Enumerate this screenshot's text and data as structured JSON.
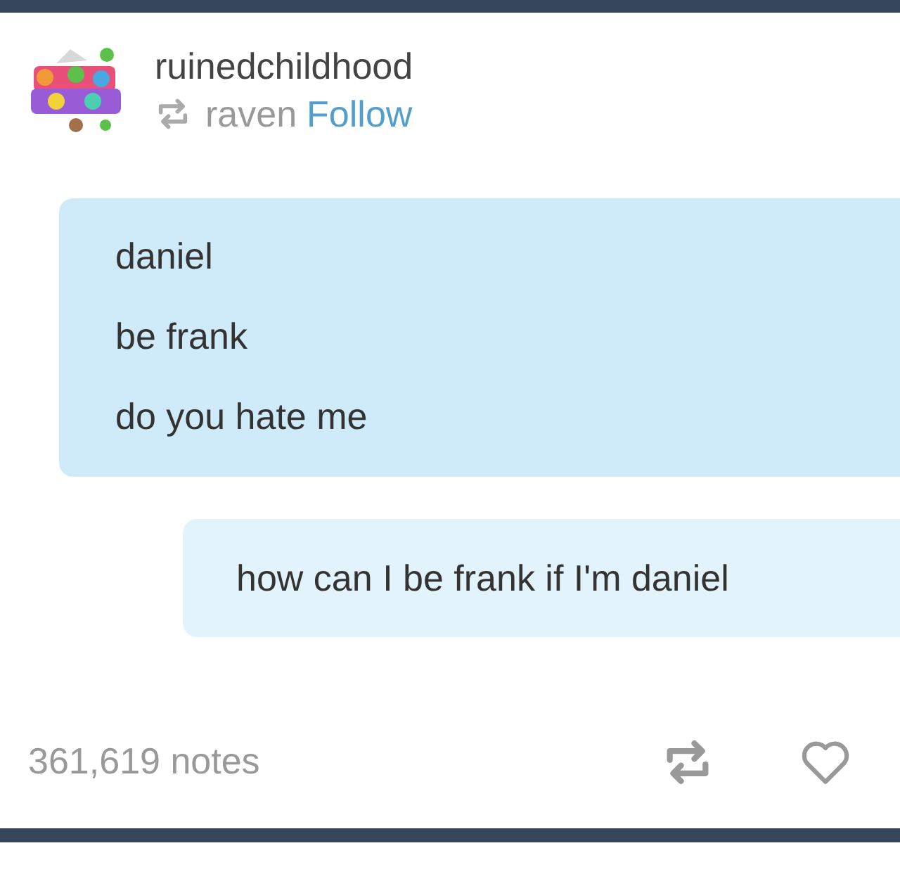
{
  "post": {
    "blog_name": "ruinedchildhood",
    "reblogged_from": "raven",
    "follow_label": "Follow"
  },
  "messages": [
    {
      "kind": "received",
      "lines": [
        "daniel",
        "be frank",
        "do you hate me"
      ]
    },
    {
      "kind": "sent",
      "lines": [
        "how can I be frank if I'm daniel"
      ]
    }
  ],
  "footer": {
    "notes": "361,619 notes"
  }
}
